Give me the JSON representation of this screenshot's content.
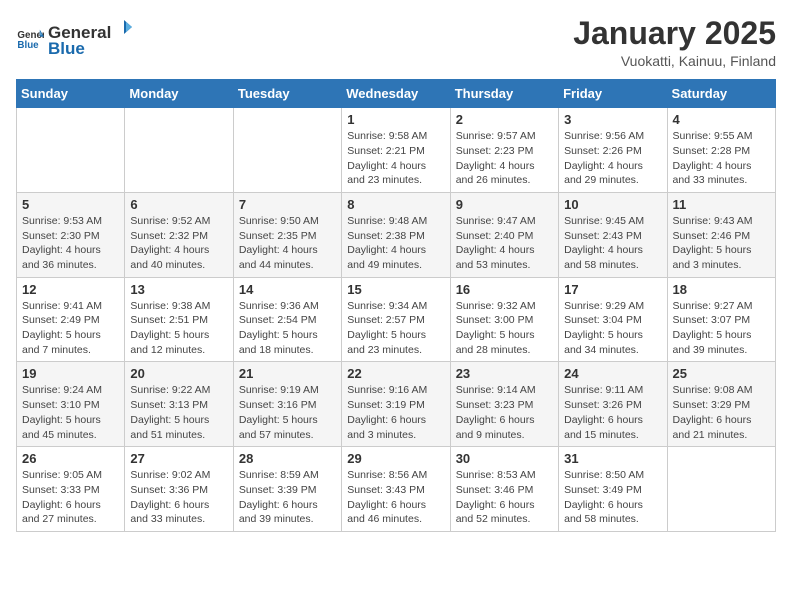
{
  "header": {
    "logo_general": "General",
    "logo_blue": "Blue",
    "title": "January 2025",
    "subtitle": "Vuokatti, Kainuu, Finland"
  },
  "weekdays": [
    "Sunday",
    "Monday",
    "Tuesday",
    "Wednesday",
    "Thursday",
    "Friday",
    "Saturday"
  ],
  "weeks": [
    [
      {
        "day": "",
        "info": ""
      },
      {
        "day": "",
        "info": ""
      },
      {
        "day": "",
        "info": ""
      },
      {
        "day": "1",
        "info": "Sunrise: 9:58 AM\nSunset: 2:21 PM\nDaylight: 4 hours and 23 minutes."
      },
      {
        "day": "2",
        "info": "Sunrise: 9:57 AM\nSunset: 2:23 PM\nDaylight: 4 hours and 26 minutes."
      },
      {
        "day": "3",
        "info": "Sunrise: 9:56 AM\nSunset: 2:26 PM\nDaylight: 4 hours and 29 minutes."
      },
      {
        "day": "4",
        "info": "Sunrise: 9:55 AM\nSunset: 2:28 PM\nDaylight: 4 hours and 33 minutes."
      }
    ],
    [
      {
        "day": "5",
        "info": "Sunrise: 9:53 AM\nSunset: 2:30 PM\nDaylight: 4 hours and 36 minutes."
      },
      {
        "day": "6",
        "info": "Sunrise: 9:52 AM\nSunset: 2:32 PM\nDaylight: 4 hours and 40 minutes."
      },
      {
        "day": "7",
        "info": "Sunrise: 9:50 AM\nSunset: 2:35 PM\nDaylight: 4 hours and 44 minutes."
      },
      {
        "day": "8",
        "info": "Sunrise: 9:48 AM\nSunset: 2:38 PM\nDaylight: 4 hours and 49 minutes."
      },
      {
        "day": "9",
        "info": "Sunrise: 9:47 AM\nSunset: 2:40 PM\nDaylight: 4 hours and 53 minutes."
      },
      {
        "day": "10",
        "info": "Sunrise: 9:45 AM\nSunset: 2:43 PM\nDaylight: 4 hours and 58 minutes."
      },
      {
        "day": "11",
        "info": "Sunrise: 9:43 AM\nSunset: 2:46 PM\nDaylight: 5 hours and 3 minutes."
      }
    ],
    [
      {
        "day": "12",
        "info": "Sunrise: 9:41 AM\nSunset: 2:49 PM\nDaylight: 5 hours and 7 minutes."
      },
      {
        "day": "13",
        "info": "Sunrise: 9:38 AM\nSunset: 2:51 PM\nDaylight: 5 hours and 12 minutes."
      },
      {
        "day": "14",
        "info": "Sunrise: 9:36 AM\nSunset: 2:54 PM\nDaylight: 5 hours and 18 minutes."
      },
      {
        "day": "15",
        "info": "Sunrise: 9:34 AM\nSunset: 2:57 PM\nDaylight: 5 hours and 23 minutes."
      },
      {
        "day": "16",
        "info": "Sunrise: 9:32 AM\nSunset: 3:00 PM\nDaylight: 5 hours and 28 minutes."
      },
      {
        "day": "17",
        "info": "Sunrise: 9:29 AM\nSunset: 3:04 PM\nDaylight: 5 hours and 34 minutes."
      },
      {
        "day": "18",
        "info": "Sunrise: 9:27 AM\nSunset: 3:07 PM\nDaylight: 5 hours and 39 minutes."
      }
    ],
    [
      {
        "day": "19",
        "info": "Sunrise: 9:24 AM\nSunset: 3:10 PM\nDaylight: 5 hours and 45 minutes."
      },
      {
        "day": "20",
        "info": "Sunrise: 9:22 AM\nSunset: 3:13 PM\nDaylight: 5 hours and 51 minutes."
      },
      {
        "day": "21",
        "info": "Sunrise: 9:19 AM\nSunset: 3:16 PM\nDaylight: 5 hours and 57 minutes."
      },
      {
        "day": "22",
        "info": "Sunrise: 9:16 AM\nSunset: 3:19 PM\nDaylight: 6 hours and 3 minutes."
      },
      {
        "day": "23",
        "info": "Sunrise: 9:14 AM\nSunset: 3:23 PM\nDaylight: 6 hours and 9 minutes."
      },
      {
        "day": "24",
        "info": "Sunrise: 9:11 AM\nSunset: 3:26 PM\nDaylight: 6 hours and 15 minutes."
      },
      {
        "day": "25",
        "info": "Sunrise: 9:08 AM\nSunset: 3:29 PM\nDaylight: 6 hours and 21 minutes."
      }
    ],
    [
      {
        "day": "26",
        "info": "Sunrise: 9:05 AM\nSunset: 3:33 PM\nDaylight: 6 hours and 27 minutes."
      },
      {
        "day": "27",
        "info": "Sunrise: 9:02 AM\nSunset: 3:36 PM\nDaylight: 6 hours and 33 minutes."
      },
      {
        "day": "28",
        "info": "Sunrise: 8:59 AM\nSunset: 3:39 PM\nDaylight: 6 hours and 39 minutes."
      },
      {
        "day": "29",
        "info": "Sunrise: 8:56 AM\nSunset: 3:43 PM\nDaylight: 6 hours and 46 minutes."
      },
      {
        "day": "30",
        "info": "Sunrise: 8:53 AM\nSunset: 3:46 PM\nDaylight: 6 hours and 52 minutes."
      },
      {
        "day": "31",
        "info": "Sunrise: 8:50 AM\nSunset: 3:49 PM\nDaylight: 6 hours and 58 minutes."
      },
      {
        "day": "",
        "info": ""
      }
    ]
  ]
}
